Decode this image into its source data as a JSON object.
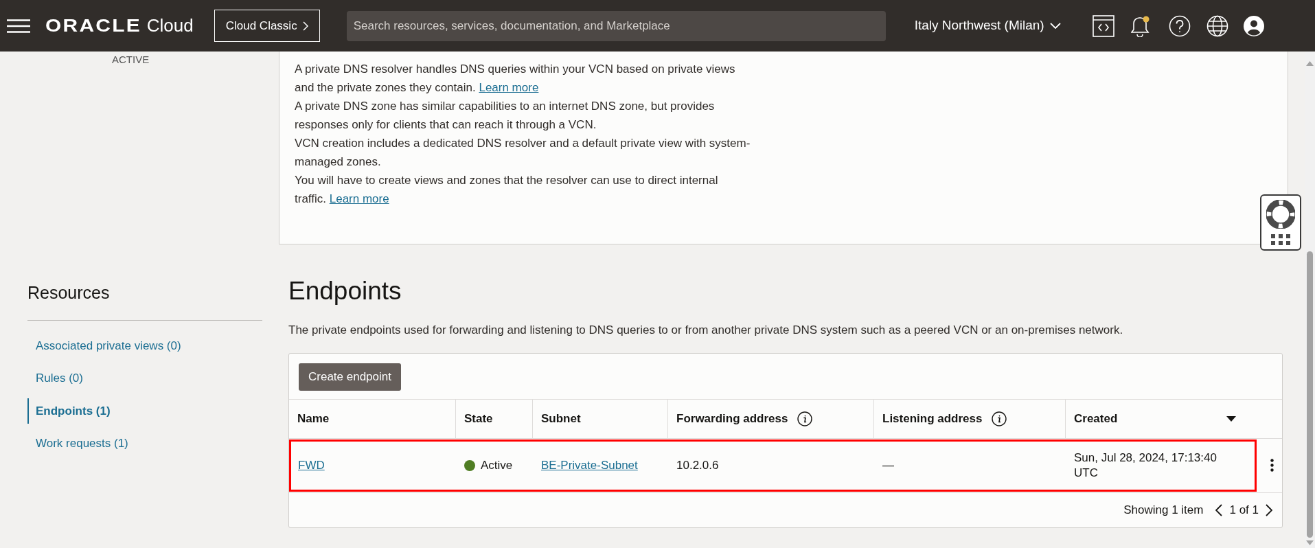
{
  "header": {
    "logo": {
      "brand": "ORACLE",
      "product": "Cloud"
    },
    "mode_button": "Cloud Classic",
    "search": {
      "placeholder": "Search resources, services, documentation, and Marketplace"
    },
    "region": "Italy Northwest (Milan)",
    "notification_unread": true
  },
  "status_label": "ACTIVE",
  "details": {
    "paragraphs": [
      {
        "text": "A private DNS resolver handles DNS queries within your VCN based on private views and the private zones they contain.",
        "link": "Learn more"
      },
      {
        "text": "A private DNS zone has similar capabilities to an internet DNS zone, but provides responses only for clients that can reach it through a VCN."
      },
      {
        "text": "VCN creation includes a dedicated DNS resolver and a default private view with system-managed zones."
      },
      {
        "text": "You will have to create views and zones that the resolver can use to direct internal traffic.",
        "link": "Learn more"
      }
    ]
  },
  "resources": {
    "title": "Resources",
    "items": [
      {
        "label": "Associated private views (0)",
        "selected": false
      },
      {
        "label": "Rules (0)",
        "selected": false
      },
      {
        "label": "Endpoints (1)",
        "selected": true
      },
      {
        "label": "Work requests (1)",
        "selected": false
      }
    ]
  },
  "endpoints": {
    "title": "Endpoints",
    "description": "The private endpoints used for forwarding and listening to DNS queries to or from another private DNS system such as a peered VCN or an on-premises network.",
    "create_button": "Create endpoint",
    "columns": [
      {
        "label": "Name",
        "info": false,
        "sortable": false
      },
      {
        "label": "State",
        "info": false,
        "sortable": false
      },
      {
        "label": "Subnet",
        "info": false,
        "sortable": false
      },
      {
        "label": "Forwarding address",
        "info": true,
        "sortable": false
      },
      {
        "label": "Listening address",
        "info": true,
        "sortable": false
      },
      {
        "label": "Created",
        "info": false,
        "sortable": true
      }
    ],
    "rows": [
      {
        "name": "FWD",
        "state": "Active",
        "color": "#4f7d23",
        "subnet": "BE-Private-Subnet",
        "forwarding_address": "10.2.0.6",
        "listening_address": "—",
        "created": "Sun, Jul 28, 2024, 17:13:40 UTC",
        "highlighted": true
      }
    ],
    "footer": {
      "summary": "Showing 1 item",
      "page": "1 of 1"
    }
  }
}
